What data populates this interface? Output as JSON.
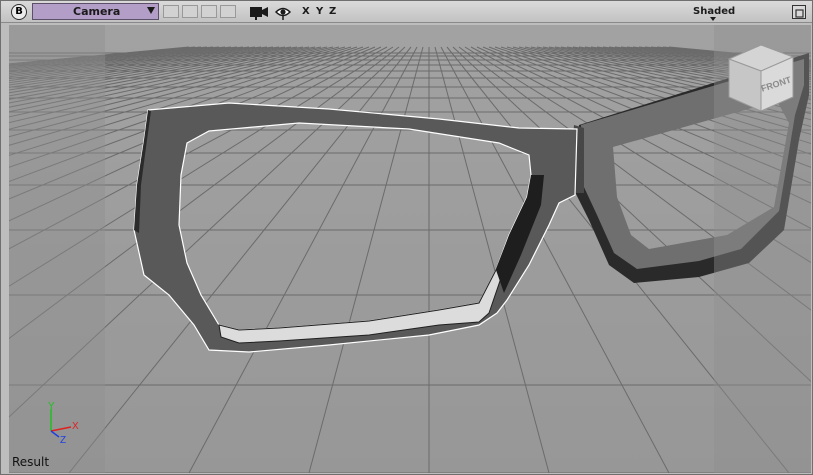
{
  "toolbar": {
    "badge": "B",
    "camera_label": "Camera",
    "axes": [
      "X",
      "Y",
      "Z"
    ],
    "shading_label": "Shaded"
  },
  "viewport": {
    "view_cube_label": "FRONT",
    "result_label": "Result",
    "axis_tripod": {
      "x": "X",
      "y": "Y",
      "z": "Z"
    }
  },
  "colors": {
    "camera_accent": "#b29ec7",
    "axis_x": "#e02020",
    "axis_y": "#20c020",
    "axis_z": "#2040e0"
  },
  "icons": [
    "camera-icon",
    "eye-icon",
    "maximize-icon",
    "view-cube-icon"
  ]
}
